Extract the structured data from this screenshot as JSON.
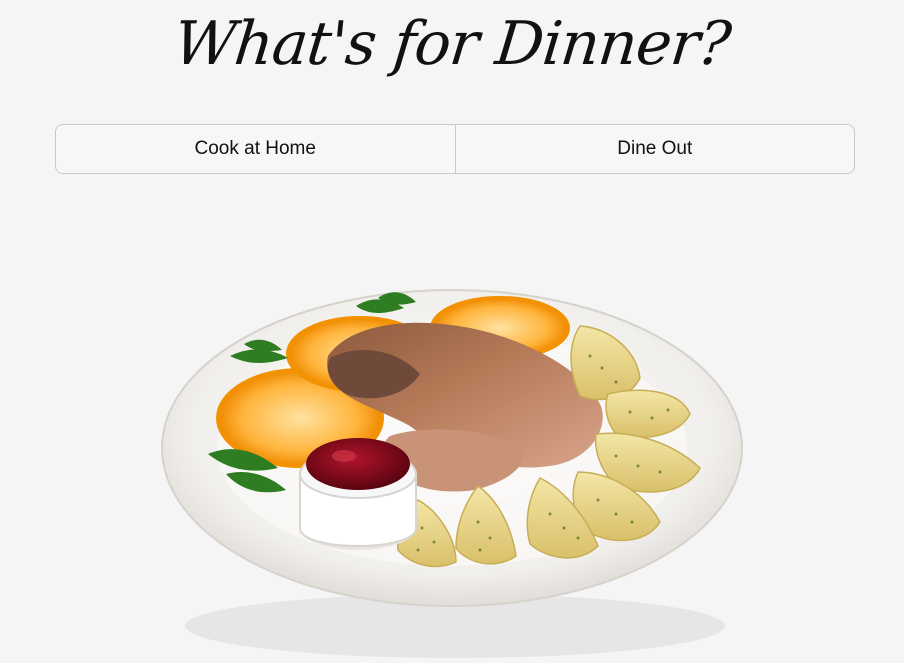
{
  "page": {
    "title": "What's for Dinner?"
  },
  "choices": [
    {
      "label": "Cook at Home"
    },
    {
      "label": "Dine Out"
    }
  ],
  "colors": {
    "background": "#f5f5f5",
    "border": "#c9c9c9",
    "text": "#111111"
  }
}
